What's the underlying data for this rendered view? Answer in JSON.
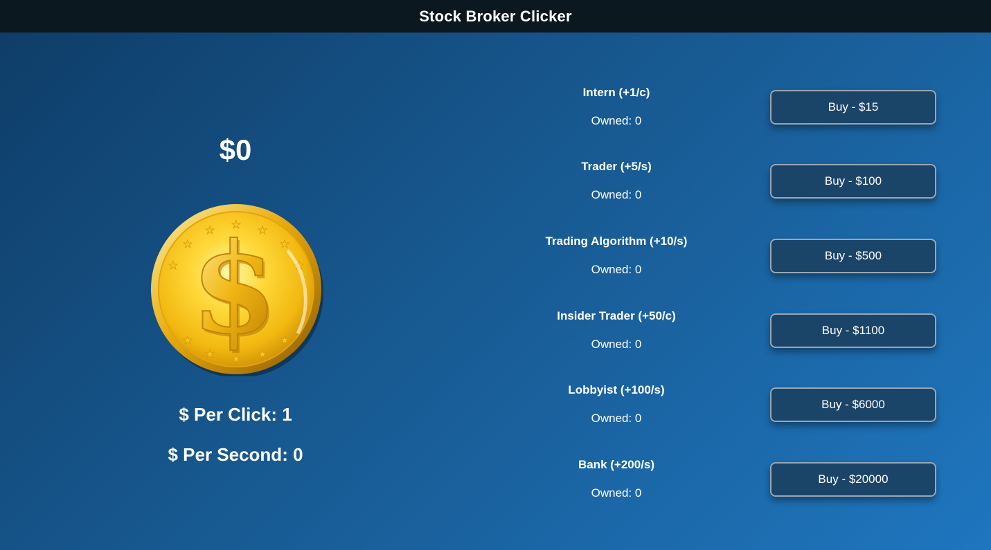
{
  "header": {
    "title": "Stock Broker Clicker"
  },
  "stats": {
    "money": "$0",
    "per_click": "$ Per Click: 1",
    "per_second": "$ Per Second: 0"
  },
  "upgrades": [
    {
      "name": "Intern (+1/c)",
      "owned": "Owned: 0",
      "buy": "Buy - $15"
    },
    {
      "name": "Trader (+5/s)",
      "owned": "Owned: 0",
      "buy": "Buy - $100"
    },
    {
      "name": "Trading Algorithm (+10/s)",
      "owned": "Owned: 0",
      "buy": "Buy - $500"
    },
    {
      "name": "Insider Trader (+50/c)",
      "owned": "Owned: 0",
      "buy": "Buy - $1100"
    },
    {
      "name": "Lobbyist (+100/s)",
      "owned": "Owned: 0",
      "buy": "Buy - $6000"
    },
    {
      "name": "Bank (+200/s)",
      "owned": "Owned: 0",
      "buy": "Buy - $20000"
    }
  ],
  "colors": {
    "header_bg": "#0c181f",
    "button_bg": "#1b4469",
    "coin_gold": "#f3c316"
  },
  "icons": {
    "coin": "gold-dollar-coin-icon"
  }
}
